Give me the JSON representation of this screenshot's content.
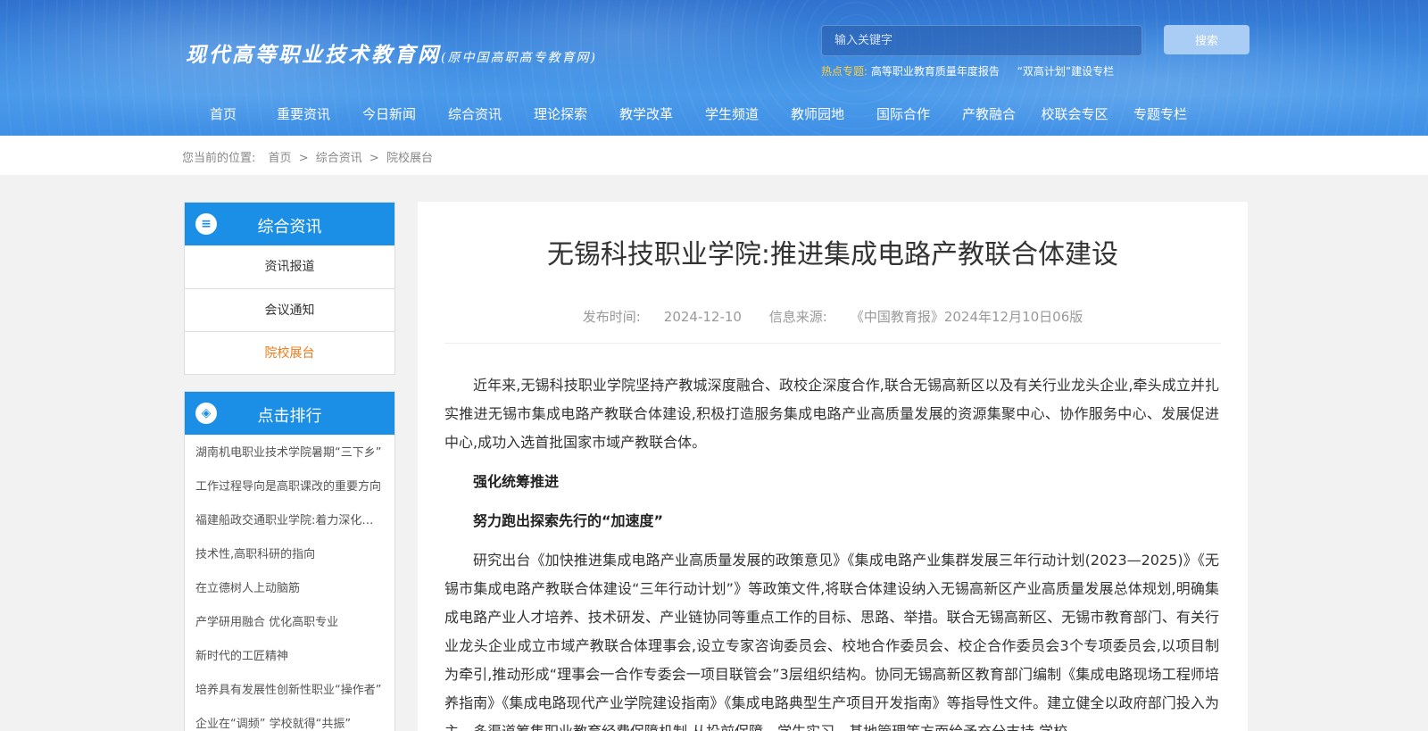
{
  "header": {
    "logo_main": "现代高等职业技术教育网",
    "logo_sub": "(原中国高职高专教育网)",
    "search_placeholder": "输入关键字",
    "search_button": "搜索",
    "hot_label": "热点专题:",
    "hot_links": [
      "高等职业教育质量年度报告",
      "“双高计划”建设专栏"
    ]
  },
  "nav": {
    "items": [
      "首页",
      "重要资讯",
      "今日新闻",
      "综合资讯",
      "理论探索",
      "教学改革",
      "学生频道",
      "教师园地",
      "国际合作",
      "产教融合",
      "校联会专区",
      "专题专栏"
    ]
  },
  "breadcrumb": {
    "prefix": "您当前的位置:",
    "items": [
      "首页",
      "综合资讯",
      "院校展台"
    ],
    "separator": ">"
  },
  "sidebar": {
    "category": {
      "title": "综合资讯",
      "icon": "list-circle-icon",
      "items": [
        "资讯报道",
        "会议通知",
        "院校展台"
      ],
      "active_index": 2
    },
    "ranking": {
      "title": "点击排行",
      "icon": "compass-icon",
      "items": [
        "湖南机电职业技术学院暑期“三下乡”",
        "工作过程导向是高职课改的重要方向",
        "福建船政交通职业学院:着力深化改革",
        "技术性,高职科研的指向",
        "在立德树人上动脑筋",
        "产学研用融合 优化高职专业",
        "新时代的工匠精神",
        "培养具有发展性创新性职业“操作者”",
        "企业在“调频” 学校就得“共振”"
      ]
    }
  },
  "article": {
    "title": "无锡科技职业学院:推进集成电路产教联合体建设",
    "publish_label": "发布时间:",
    "publish_date": "2024-12-10",
    "source_label": "信息来源:",
    "source": "《中国教育报》2024年12月10日06版",
    "paragraphs": [
      "近年来,无锡科技职业学院坚持产教城深度融合、政校企深度合作,联合无锡高新区以及有关行业龙头企业,牵头成立并扎实推进无锡市集成电路产教联合体建设,积极打造服务集成电路产业高质量发展的资源集聚中心、协作服务中心、发展促进中心,成功入选首批国家市域产教联合体。",
      "研究出台《加快推进集成电路产业高质量发展的政策意见》《集成电路产业集群发展三年行动计划(2023—2025)》《无锡市集成电路产教联合体建设“三年行动计划”》等政策文件,将联合体建设纳入无锡高新区产业高质量发展总体规划,明确集成电路产业人才培养、技术研发、产业链协同等重点工作的目标、思路、举措。联合无锡高新区、无锡市教育部门、有关行业龙头企业成立市域产教联合体理事会,设立专家咨询委员会、校地合作委员会、校企合作委员会3个专项委员会,以项目制为牵引,推动形成“理事会一合作专委会一项目联管会”3层组织结构。协同无锡高新区教育部门编制《集成电路现场工程师培养指南》《集成电路现代产业学院建设指南》《集成电路典型生产项目开发指南》等指导性文件。建立健全以政府部门投入为主、多渠道筹集职业教育经费保障机制,从投前保障、学生实习、基地管理等方面给予充分支持,学校"
    ],
    "headings": [
      "强化统筹推进",
      "努力跑出探索先行的“加速度”"
    ]
  }
}
